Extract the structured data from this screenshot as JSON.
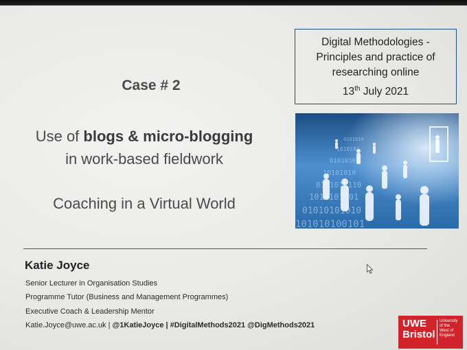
{
  "info_box": {
    "line1": "Digital Methodologies -",
    "line2": "Principles and practice of",
    "line3": "researching online",
    "date_day": "13",
    "date_suffix": "th",
    "date_rest": " July 2021"
  },
  "slide": {
    "case_title": "Case # 2",
    "subtitle_prefix": "Use of ",
    "subtitle_bold": "blogs & micro-blogging",
    "subtitle_line2": "in work-based fieldwork",
    "subtitle2": "Coaching in a Virtual World"
  },
  "presenter": {
    "name": "Katie Joyce",
    "roles": [
      "Senior Lecturer in Organisation Studies",
      "Programme Tutor (Business and Management Programmes)",
      "Executive Coach & Leadership Mentor"
    ],
    "email": "Katie.Joyce@uwe.ac.uk",
    "sep": " | ",
    "handle": "@1KatieJoyce",
    "hashtag_part": " | #DigitalMethods2021  @DigMethods2021"
  },
  "logo": {
    "line1": "UWE",
    "line2": "Bristol",
    "small1": "University",
    "small2": "of the",
    "small3": "West of",
    "small4": "England"
  },
  "photo": {
    "binary_rows": [
      "0101010",
      "1010101",
      "01010101",
      "10101010",
      "0101010110",
      "1010101001",
      "01010101010",
      "101010100101"
    ]
  },
  "colors": {
    "box_border": "#1f4f78",
    "logo_red": "#d2232a",
    "photo_blue": "#3a7cc0"
  }
}
